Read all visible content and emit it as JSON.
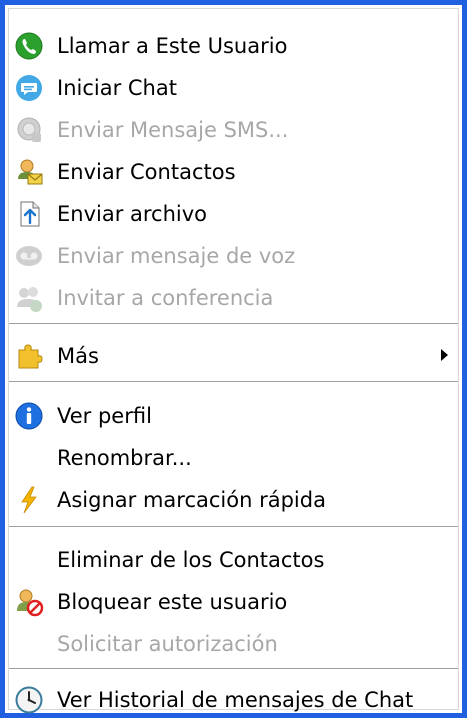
{
  "menu": {
    "items": [
      {
        "label": "Llamar a Este Usuario",
        "icon": "phone-icon",
        "enabled": true
      },
      {
        "label": "Iniciar Chat",
        "icon": "chat-icon",
        "enabled": true
      },
      {
        "label": "Enviar Mensaje SMS...",
        "icon": "sms-icon",
        "enabled": false
      },
      {
        "label": "Enviar Contactos",
        "icon": "send-contacts-icon",
        "enabled": true
      },
      {
        "label": "Enviar archivo",
        "icon": "file-upload-icon",
        "enabled": true
      },
      {
        "label": "Enviar mensaje de voz",
        "icon": "voice-message-icon",
        "enabled": false
      },
      {
        "label": "Invitar a conferencia",
        "icon": "conference-icon",
        "enabled": false
      },
      {
        "label": "Más",
        "icon": "puzzle-icon",
        "enabled": true,
        "submenu": true
      },
      {
        "label": "Ver perfil",
        "icon": "info-icon",
        "enabled": true
      },
      {
        "label": "Renombrar...",
        "icon": "",
        "enabled": true
      },
      {
        "label": "Asignar marcación rápida",
        "icon": "lightning-icon",
        "enabled": true
      },
      {
        "label": "Eliminar de los Contactos",
        "icon": "",
        "enabled": true
      },
      {
        "label": "Bloquear este usuario",
        "icon": "block-user-icon",
        "enabled": true
      },
      {
        "label": "Solicitar autorización",
        "icon": "",
        "enabled": false
      },
      {
        "label": "Ver Historial de mensajes de Chat",
        "icon": "history-clock-icon",
        "enabled": true
      }
    ]
  },
  "colors": {
    "frame": "#1f5fe0",
    "text": "#000000",
    "disabled_text": "#a7a7a7",
    "separator": "#a0a0a0"
  }
}
